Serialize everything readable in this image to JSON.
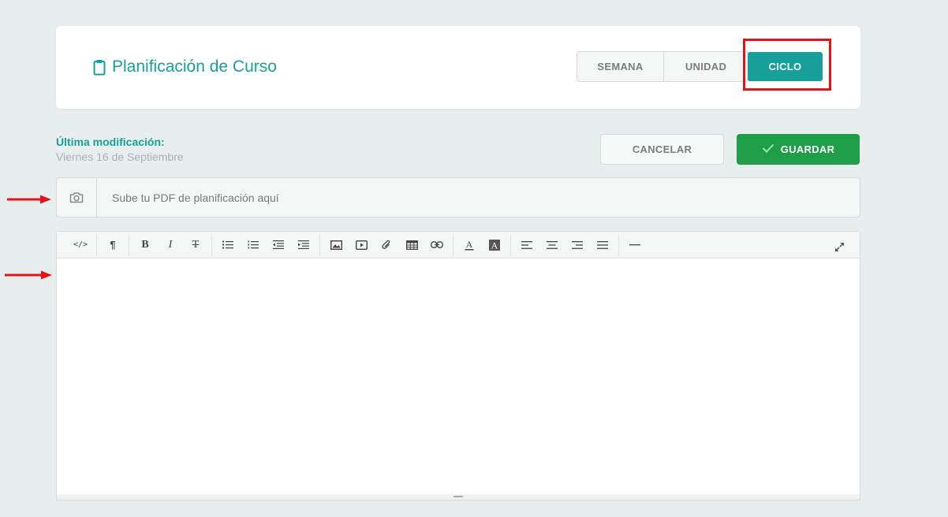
{
  "header": {
    "title": "Planificación de Curso",
    "tabs": [
      {
        "label": "SEMANA",
        "active": false
      },
      {
        "label": "UNIDAD",
        "active": false
      },
      {
        "label": "CICLO",
        "active": true
      }
    ]
  },
  "modification": {
    "label": "Última modificación:",
    "date": "Viernes 16 de Septiembre"
  },
  "actions": {
    "cancel_label": "CANCELAR",
    "save_label": "GUARDAR"
  },
  "upload": {
    "placeholder": "Sube tu PDF de planificación aquí",
    "icon": "camera-icon"
  },
  "editor": {
    "content": "",
    "toolbar_icons": [
      "code-view-icon",
      "paragraph-icon",
      "bold-icon",
      "italic-icon",
      "strikethrough-icon",
      "unordered-list-icon",
      "ordered-list-icon",
      "outdent-icon",
      "indent-icon",
      "image-icon",
      "video-icon",
      "attachment-icon",
      "table-icon",
      "link-icon",
      "text-color-icon",
      "background-color-icon",
      "align-left-icon",
      "align-center-icon",
      "align-right-icon",
      "align-justify-icon",
      "horizontal-rule-icon",
      "fullscreen-icon"
    ]
  },
  "colors": {
    "accent": "#17a09a",
    "save": "#1e9e49",
    "annotation": "#e8101a",
    "background": "#e8eded"
  }
}
